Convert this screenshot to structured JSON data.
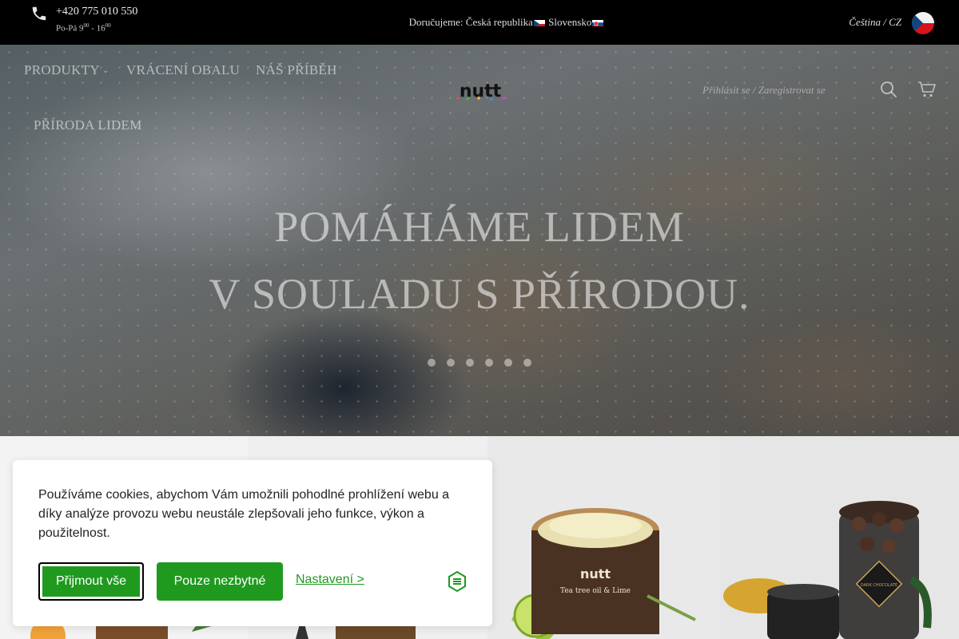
{
  "topbar": {
    "phone": "+420 775 010 550",
    "hours_prefix": "Po-Pá 9",
    "hours_sup1": "00",
    "hours_mid": " - 16",
    "hours_sup2": "00",
    "delivery_label": "Doručujeme: Česká republika",
    "delivery_sk": "Slovensko",
    "language": "Čeština / CZ"
  },
  "nav": {
    "items": [
      "PRODUKTY",
      "VRÁCENÍ OBALU",
      "NÁŠ PŘÍBĚH",
      "PŘÍRODA LIDEM"
    ],
    "logo_text": "nutt",
    "login": "Přihlásit se / Zaregistrovat se"
  },
  "hero": {
    "line1": "POMÁHÁME LIDEM",
    "line2": "V SOULADU S PŘÍRODOU.",
    "slide_count": 6
  },
  "products": {
    "jar_label": "nutt",
    "jar_sublabel": "Tea tree oil & Lime",
    "jar_label_2": "DARK CHOCOLATE"
  },
  "cookie": {
    "text": "Používáme cookies, abychom Vám umožnili pohodlné prohlížení webu a díky analýze provozu webu neustále zlepšovali jeho funkce, výkon a použitelnost.",
    "accept_all": "Přijmout vše",
    "only_necessary": "Pouze nezbytné",
    "settings": "Nastavení >"
  },
  "colors": {
    "topbar_bg": "#000000",
    "accent_green": "#1f9a1f",
    "banner_bg": "#ffffff"
  },
  "icons": [
    "phone-icon",
    "search-icon",
    "cart-icon",
    "shield-icon",
    "cz-flag",
    "sk-flag"
  ]
}
